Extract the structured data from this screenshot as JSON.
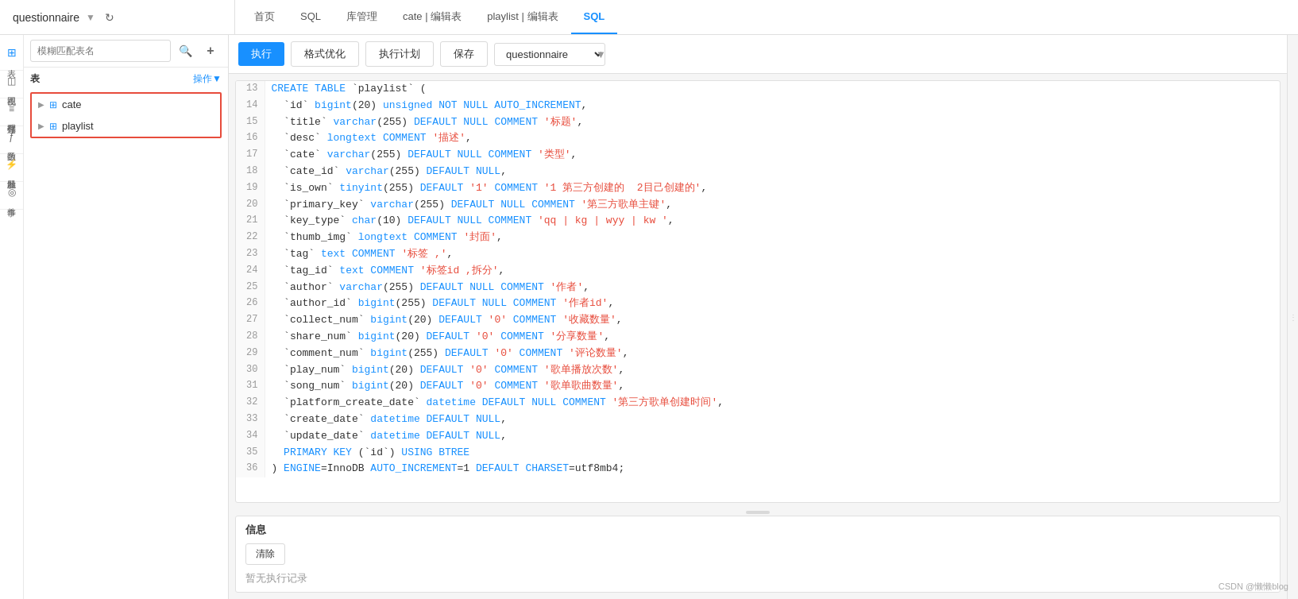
{
  "app": {
    "db_name": "questionnaire",
    "watermark": "CSDN @懒懒blog"
  },
  "top_nav": {
    "tabs": [
      {
        "label": "首页",
        "active": false
      },
      {
        "label": "SQL",
        "active": false
      },
      {
        "label": "库管理",
        "active": false
      },
      {
        "label": "cate | 编辑表",
        "active": false
      },
      {
        "label": "playlist | 编辑表",
        "active": false
      },
      {
        "label": "SQL",
        "active": true
      }
    ]
  },
  "left_sidebar": {
    "icons": [
      {
        "label": "表",
        "symbol": "⊞"
      },
      {
        "label": "视图",
        "symbol": "◫"
      },
      {
        "label": "存储过程",
        "symbol": "≡"
      },
      {
        "label": "函数",
        "symbol": "ƒ"
      },
      {
        "label": "触发器",
        "symbol": "⚡"
      },
      {
        "label": "事件",
        "symbol": "◎"
      }
    ]
  },
  "left_panel": {
    "search_placeholder": "模糊匹配表名",
    "section_label": "表",
    "operate_label": "操作▼",
    "tables": [
      {
        "name": "cate",
        "expanded": false
      },
      {
        "name": "playlist",
        "expanded": false
      }
    ]
  },
  "toolbar": {
    "execute_label": "执行",
    "format_label": "格式优化",
    "plan_label": "执行计划",
    "save_label": "保存",
    "db_value": "questionnaire"
  },
  "code_lines": [
    {
      "num": 13,
      "html": "<span class='kw'>CREATE TABLE</span> `playlist` ("
    },
    {
      "num": 14,
      "html": "  `id` <span class='kw'>bigint</span>(20) <span class='kw'>unsigned NOT NULL AUTO_INCREMENT</span>,"
    },
    {
      "num": 15,
      "html": "  `title` <span class='kw'>varchar</span>(255) <span class='kw'>DEFAULT NULL</span> <span class='kw'>COMMENT</span> <span class='str'>'标题'</span>,"
    },
    {
      "num": 16,
      "html": "  `desc` <span class='kw'>longtext</span> <span class='kw'>COMMENT</span> <span class='str'>'描述'</span>,"
    },
    {
      "num": 17,
      "html": "  `cate` <span class='kw'>varchar</span>(255) <span class='kw'>DEFAULT NULL</span> <span class='kw'>COMMENT</span> <span class='str'>'类型'</span>,"
    },
    {
      "num": 18,
      "html": "  `cate_id` <span class='kw'>varchar</span>(255) <span class='kw'>DEFAULT NULL</span>,"
    },
    {
      "num": 19,
      "html": "  `is_own` <span class='kw'>tinyint</span>(255) <span class='kw'>DEFAULT</span> <span class='str'>'1'</span> <span class='kw'>COMMENT</span> <span class='str'>'1 第三方创建的  2目己创建的'</span>,"
    },
    {
      "num": 20,
      "html": "  `primary_key` <span class='kw'>varchar</span>(255) <span class='kw'>DEFAULT NULL</span> <span class='kw'>COMMENT</span> <span class='str'>'第三方歌单主键'</span>,"
    },
    {
      "num": 21,
      "html": "  `key_type` <span class='kw'>char</span>(10) <span class='kw'>DEFAULT NULL</span> <span class='kw'>COMMENT</span> <span class='str'>'qq | kg | wyy | kw '</span>,"
    },
    {
      "num": 22,
      "html": "  `thumb_img` <span class='kw'>longtext</span> <span class='kw'>COMMENT</span> <span class='str'>'封面'</span>,"
    },
    {
      "num": 23,
      "html": "  `tag` <span class='kw'>text</span> <span class='kw'>COMMENT</span> <span class='str'>'标签 ,'</span>,"
    },
    {
      "num": 24,
      "html": "  `tag_id` <span class='kw'>text</span> <span class='kw'>COMMENT</span> <span class='str'>'标签id ,拆分'</span>,"
    },
    {
      "num": 25,
      "html": "  `author` <span class='kw'>varchar</span>(255) <span class='kw'>DEFAULT NULL</span> <span class='kw'>COMMENT</span> <span class='str'>'作者'</span>,"
    },
    {
      "num": 26,
      "html": "  `author_id` <span class='kw'>bigint</span>(255) <span class='kw'>DEFAULT NULL</span> <span class='kw'>COMMENT</span> <span class='str'>'作者id'</span>,"
    },
    {
      "num": 27,
      "html": "  `collect_num` <span class='kw'>bigint</span>(20) <span class='kw'>DEFAULT</span> <span class='str'>'0'</span> <span class='kw'>COMMENT</span> <span class='str'>'收藏数量'</span>,"
    },
    {
      "num": 28,
      "html": "  `share_num` <span class='kw'>bigint</span>(20) <span class='kw'>DEFAULT</span> <span class='str'>'0'</span> <span class='kw'>COMMENT</span> <span class='str'>'分享数量'</span>,"
    },
    {
      "num": 29,
      "html": "  `comment_num` <span class='kw'>bigint</span>(255) <span class='kw'>DEFAULT</span> <span class='str'>'0'</span> <span class='kw'>COMMENT</span> <span class='str'>'评论数量'</span>,"
    },
    {
      "num": 30,
      "html": "  `play_num` <span class='kw'>bigint</span>(20) <span class='kw'>DEFAULT</span> <span class='str'>'0'</span> <span class='kw'>COMMENT</span> <span class='str'>'歌单播放次数'</span>,"
    },
    {
      "num": 31,
      "html": "  `song_num` <span class='kw'>bigint</span>(20) <span class='kw'>DEFAULT</span> <span class='str'>'0'</span> <span class='kw'>COMMENT</span> <span class='str'>'歌单歌曲数量'</span>,"
    },
    {
      "num": 32,
      "html": "  `platform_create_date` <span class='kw'>datetime DEFAULT NULL</span> <span class='kw'>COMMENT</span> <span class='str'>'第三方歌单创建时间'</span>,"
    },
    {
      "num": 33,
      "html": "  `create_date` <span class='kw'>datetime DEFAULT NULL</span>,"
    },
    {
      "num": 34,
      "html": "  `update_date` <span class='kw'>datetime DEFAULT NULL</span>,"
    },
    {
      "num": 35,
      "html": "  <span class='kw'>PRIMARY KEY</span> (`id`) <span class='kw'>USING BTREE</span>"
    },
    {
      "num": 36,
      "html": ") <span class='kw'>ENGINE</span>=InnoDB <span class='kw'>AUTO_INCREMENT</span>=1 <span class='kw'>DEFAULT CHARSET</span>=utf8mb4;"
    }
  ],
  "info_section": {
    "title": "信息",
    "clear_label": "清除",
    "no_record": "暂无执行记录"
  }
}
